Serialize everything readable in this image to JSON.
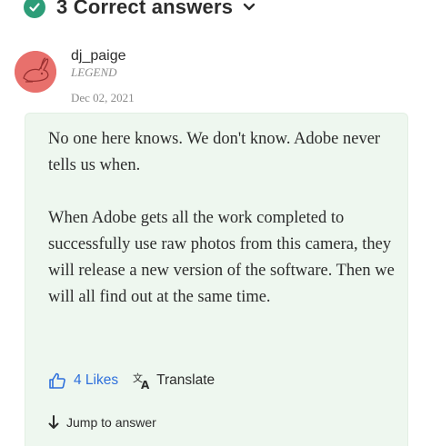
{
  "header": {
    "title": "3 Correct answers",
    "check_icon": "check-circle-icon",
    "chevron_icon": "chevron-down-icon",
    "accent_color": "#2d9d78"
  },
  "author": {
    "name": "dj_paige",
    "rank": "LEGEND",
    "date": "Dec 02, 2021",
    "avatar_icon": "rabbit-avatar"
  },
  "answer": {
    "paragraphs": [
      "No one here knows. We don't know. Adobe never tells us when.",
      "When Adobe gets all the work completed to successfully use raw photos from this camera, they will release a new version of the software. Then we will all find out at the same time."
    ],
    "background_color": "#eef7ef"
  },
  "actions": {
    "likes_label": "4 Likes",
    "translate_label": "Translate",
    "jump_label": "Jump to answer",
    "link_color": "#2d6fdc"
  }
}
